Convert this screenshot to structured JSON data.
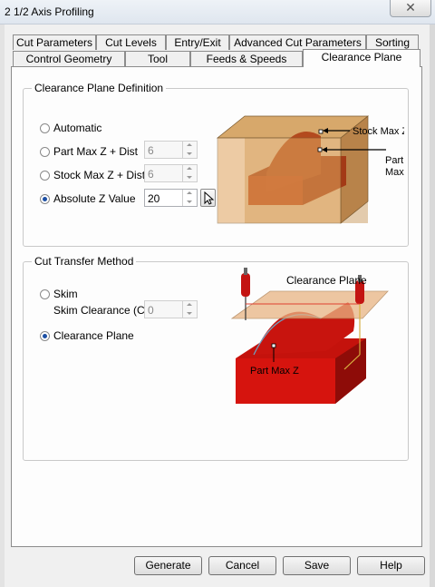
{
  "window": {
    "title": "2 1/2 Axis Profiling",
    "close_glyph": "✕"
  },
  "tabs_back": [
    "Cut Parameters",
    "Cut Levels",
    "Entry/Exit",
    "Advanced Cut Parameters",
    "Sorting"
  ],
  "tabs_front": [
    "Control Geometry",
    "Tool",
    "Feeds & Speeds",
    "Clearance Plane"
  ],
  "active_tab": "Clearance Plane",
  "clearance_definition": {
    "title": "Clearance Plane Definition",
    "options": [
      {
        "label": "Automatic",
        "selected": false
      },
      {
        "label": "Part Max Z + Dist",
        "selected": false,
        "value": "6",
        "enabled": false
      },
      {
        "label": "Stock Max Z + Dist",
        "selected": false,
        "value": "6",
        "enabled": false
      },
      {
        "label": "Absolute Z Value",
        "selected": true,
        "value": "20",
        "enabled": true
      }
    ],
    "diagram_labels": {
      "stock_max_z": "Stock Max Z",
      "part_max_z_line1": "Part",
      "part_max_z_line2": "Max Z"
    }
  },
  "cut_transfer": {
    "title": "Cut Transfer Method",
    "options": [
      {
        "label": "Skim",
        "selected": false
      },
      {
        "label": "Clearance Plane",
        "selected": true
      }
    ],
    "skim_clearance_label": "Skim Clearance (C)",
    "skim_clearance_value": "0",
    "diagram_labels": {
      "clearance_plane": "Clearance Plane",
      "part_max_z": "Part Max Z"
    }
  },
  "buttons": {
    "generate": "Generate",
    "cancel": "Cancel",
    "save": "Save",
    "help": "Help"
  },
  "icons": [
    "arrow-pointer-icon",
    "close-icon"
  ]
}
